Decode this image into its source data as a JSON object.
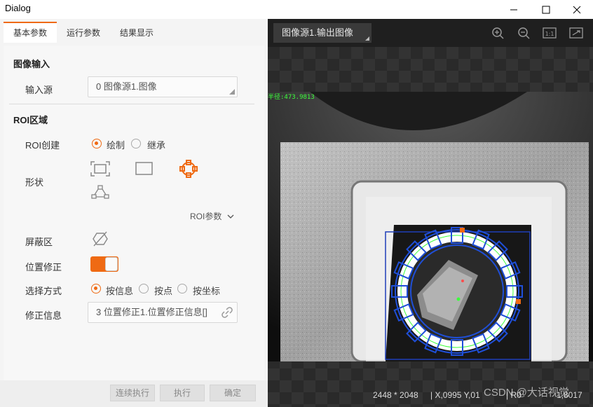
{
  "window": {
    "title": "Dialog",
    "minimize": "—",
    "maximize": "☐",
    "close": "✕"
  },
  "tabs": [
    "基本参数",
    "运行参数",
    "结果显示"
  ],
  "image_input": {
    "section": "图像输入",
    "source_label": "输入源",
    "source_value": "0 图像源1.图像"
  },
  "roi": {
    "section": "ROI区域",
    "create_label": "ROI创建",
    "create_options": [
      "绘制",
      "继承"
    ],
    "shape_label": "形状",
    "params_label": "ROI参数",
    "mask_label": "屏蔽区",
    "position_fix_label": "位置修正",
    "select_method_label": "选择方式",
    "select_options": [
      "按信息",
      "按点",
      "按坐标"
    ],
    "fix_info_label": "修正信息",
    "fix_info_value": "3 位置修正1.位置修正信息[]"
  },
  "buttons": {
    "run_continuous": "连续执行",
    "run": "执行",
    "ok": "确定"
  },
  "viewer": {
    "tab": "图像源1.输出图像",
    "overlay_text": "半径:473.9813",
    "image_size": "2448 * 2048",
    "coord": "| X,0995  Y,01",
    "roi_text": "| R0 ",
    "extra": "1,8017",
    "watermark": "CSDN @大话视觉"
  },
  "colors": {
    "accent": "#ef6a13",
    "roi_blue": "#1f4fd8",
    "overlay_green": "#3cff3c"
  }
}
